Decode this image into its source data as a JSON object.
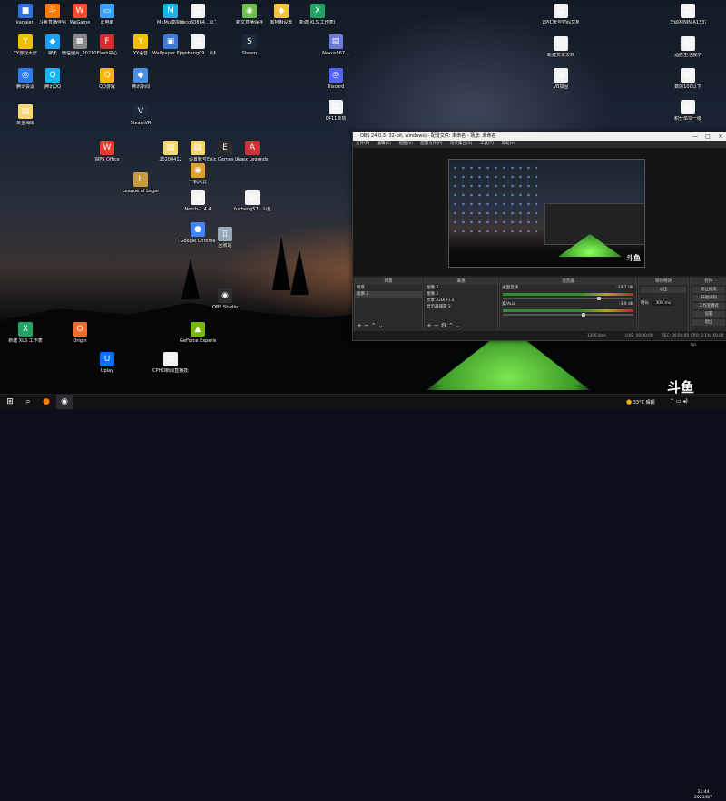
{
  "desktop_icons": [
    {
      "label": "kanaleri",
      "glyph": "■",
      "color": "#2b6fe0"
    },
    {
      "label": "斗鱼直播伴侣",
      "glyph": "斗",
      "color": "#ff7a00"
    },
    {
      "label": "WeGame",
      "glyph": "W",
      "color": "#ff4b2b"
    },
    {
      "label": "此电脑",
      "glyph": "▭",
      "color": "#3aa0ff"
    },
    {
      "label": "MuMu模拟器",
      "glyph": "M",
      "color": "#19b3e6"
    },
    {
      "label": "heco60864...以下",
      "glyph": "▤",
      "color": "#f2f2f2"
    },
    {
      "label": "新文直播保存",
      "glyph": "◉",
      "color": "#6bc04b"
    },
    {
      "label": "客MIN设置",
      "glyph": "◆",
      "color": "#f5c242"
    },
    {
      "label": "新建 XLS 工作表(2)",
      "glyph": "X",
      "color": "#21a366"
    },
    {
      "label": "YY游戏大厅",
      "glyph": "Y",
      "color": "#f0c000"
    },
    {
      "label": "聊天",
      "glyph": "◆",
      "color": "#1aa1f2"
    },
    {
      "label": "微信图片_2021052...",
      "glyph": "▩",
      "color": "#888"
    },
    {
      "label": "Flash中心",
      "glyph": "F",
      "color": "#d23030"
    },
    {
      "label": "YY语音",
      "glyph": "Y",
      "color": "#f0c000"
    },
    {
      "label": "Wallpaper Engine",
      "glyph": "▣",
      "color": "#3a7bd5"
    },
    {
      "label": "jiechang09...素材",
      "glyph": "▤",
      "color": "#f2f2f2"
    },
    {
      "label": "Steam",
      "glyph": "S",
      "color": "#1b2838"
    },
    {
      "label": "Nexus567...",
      "glyph": "▤",
      "color": "#6a7bd8"
    },
    {
      "label": "腾讯会议",
      "glyph": "◎",
      "color": "#2d7cf0"
    },
    {
      "label": "腾讯QQ",
      "glyph": "Q",
      "color": "#12b7f5"
    },
    {
      "label": "QQ游戏",
      "glyph": "Q",
      "color": "#ffb400"
    },
    {
      "label": "腾讯新闻",
      "glyph": "◆",
      "color": "#4a90e2"
    },
    {
      "label": "Origin",
      "glyph": "O",
      "color": "#f56c2d"
    },
    {
      "label": "OBS Studio",
      "glyph": "◉",
      "color": "#302e31"
    },
    {
      "label": "Uplay",
      "glyph": "U",
      "color": "#0070ff"
    },
    {
      "label": "新建 XLS 工作表",
      "glyph": "X",
      "color": "#21a366"
    },
    {
      "label": "League of Legends",
      "glyph": "L",
      "color": "#c89b3c"
    },
    {
      "label": "Epic Games Launcher",
      "glyph": "E",
      "color": "#2a2a2a"
    },
    {
      "label": "Apex Legends",
      "glyph": "A",
      "color": "#cd3333"
    },
    {
      "label": "Google Chrome",
      "glyph": "●",
      "color": "#4285f4"
    },
    {
      "label": "WPS Office",
      "glyph": "W",
      "color": "#e53a2e"
    },
    {
      "label": "GeForce Experience",
      "glyph": "▲",
      "color": "#76b900"
    },
    {
      "label": "回收站",
      "glyph": "▯",
      "color": "#9ab"
    },
    {
      "label": "Netch-1.4.4",
      "glyph": "▤",
      "color": "#f2f2f2"
    },
    {
      "label": "fucheng57...山猫美西装",
      "glyph": "▤",
      "color": "#f2f2f2"
    },
    {
      "label": "黄金海岸",
      "glyph": "▤",
      "color": "#f5d76e"
    },
    {
      "label": "SteamVR",
      "glyph": "V",
      "color": "#1b2838"
    },
    {
      "label": "20200412",
      "glyph": "▤",
      "color": "#f5d76e"
    },
    {
      "label": "设置账号",
      "glyph": "▤",
      "color": "#f5d76e"
    },
    {
      "label": "千帆风云",
      "glyph": "◉",
      "color": "#e0a030"
    },
    {
      "label": "CPHD新闻直播技术",
      "glyph": "▤",
      "color": "#f2f2f2"
    },
    {
      "label": "Discord",
      "glyph": "◎",
      "color": "#5865f2"
    },
    {
      "label": "0411单项",
      "glyph": "▤",
      "color": "#f2f2f2"
    },
    {
      "label": "VB加固",
      "glyph": "▤",
      "color": "#f2f2f2"
    },
    {
      "label": "新建文本文档",
      "glyph": "▤",
      "color": "#f2f2f2"
    },
    {
      "label": "积分单项一级",
      "glyph": "▤",
      "color": "#f2f2f2"
    },
    {
      "label": "EPIC账号密码文档",
      "glyph": "▤",
      "color": "#f2f2f2"
    },
    {
      "label": "华硕材NINJA1337...",
      "glyph": "▤",
      "color": "#f2f2f2"
    },
    {
      "label": "酒店生活展示",
      "glyph": "▤",
      "color": "#f2f2f2"
    },
    {
      "label": "数的100以下",
      "glyph": "▤",
      "color": "#f2f2f2"
    }
  ],
  "obs": {
    "title": "OBS 24.0.3 (32-bit, windows) - 配置文件: 未命名 - 场景: 未命名",
    "menu": [
      "文件(F)",
      "编辑(E)",
      "视图(V)",
      "配置文件(P)",
      "场景集合(S)",
      "工具(T)",
      "帮助(H)"
    ],
    "docks": {
      "scenes": {
        "title": "场景",
        "items": [
          "场景",
          "场景 2"
        ],
        "selected_index": 1
      },
      "sources": {
        "title": "来源",
        "items": [
          "图像 3",
          "图像 2",
          "文本 (GDI+) 3",
          "显示器捕获 2"
        ]
      },
      "mixer": {
        "title": "混音器",
        "tracks": [
          {
            "name": "桌面音频",
            "db": "-10.7 dB",
            "level": 0.74
          },
          {
            "name": "麦/Aux",
            "db": "-3.9 dB",
            "level": 0.62
          }
        ]
      },
      "transitions": {
        "title": "转场特效",
        "mode": "淡出",
        "duration_label": "时长",
        "duration_value": "300 ms"
      },
      "controls": {
        "title": "控件",
        "buttons": [
          "停止推流",
          "开始录制",
          "工作室模式",
          "设置",
          "退出"
        ]
      }
    },
    "status": {
      "fps_label": "LIVE: 00:00:00",
      "rec_label": "REC: 00:00:00",
      "cpu": "CPU: 3.1%, 60.00 fps",
      "kbps": "1296 kb/s"
    }
  },
  "taskbar": {
    "weather": "33°C 晴朗",
    "time": "21:44",
    "date": "2021/8/7",
    "brand": "斗鱼"
  }
}
